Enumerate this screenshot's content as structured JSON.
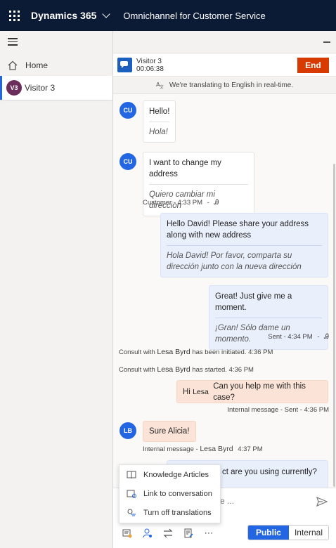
{
  "topbar": {
    "brand": "Dynamics 365",
    "app_name": "Omnichannel for Customer Service"
  },
  "nav": {
    "home_label": "Home",
    "visitor_initials": "V3",
    "visitor_label": "Visitor 3"
  },
  "session": {
    "name": "Visitor 3",
    "timer": "00:06:38",
    "end_label": "End"
  },
  "translate_banner": "We're translating to English in real-time.",
  "messages": [
    {
      "initials": "CU",
      "original": "Hello!",
      "translation": "Hola!"
    },
    {
      "initials": "CU",
      "original": "I want to change my address",
      "translation": "Quiero cambiar mi direccion",
      "meta": "Customer - 4:33 PM"
    },
    {
      "original": "Hello David! Please share your address along with new address",
      "translation": "Hola David! Por favor, comparta su dirección junto con la nueva dirección"
    },
    {
      "original": "Great! Just give me a moment.",
      "translation": "¡Gran! Sólo dame un momento.",
      "meta": "Sent - 4:34 PM"
    }
  ],
  "system": [
    {
      "prefix": "Consult with",
      "who": "Lesa Byrd",
      "suffix": "has been initiated. 4:36 PM"
    },
    {
      "prefix": "Consult with",
      "who": "Lesa Byrd",
      "suffix": "has started. 4:36 PM"
    }
  ],
  "internal_message": {
    "prefix": "Hi",
    "who": "Lesa",
    "text": "Can you help me with this case?",
    "meta": "Internal message - Sent - 4:36 PM"
  },
  "consultant_message": {
    "initials": "LB",
    "text": "Sure Alicia!",
    "meta_prefix": "Internal message -",
    "meta_who": "Lesa Byrd",
    "meta_time": "4:37 PM"
  },
  "partial_message": "ct are you using currently?",
  "compose": {
    "placeholder": "essage ..."
  },
  "popup_menu": [
    {
      "icon": "book-icon",
      "label": "Knowledge Articles"
    },
    {
      "icon": "link-icon",
      "label": "Link to conversation"
    },
    {
      "icon": "translate-icon",
      "label": "Turn off translations"
    }
  ],
  "toggle": {
    "public": "Public",
    "internal": "Internal"
  },
  "colors": {
    "topbar": "#0b1a35",
    "accent": "#2266e3",
    "end_button": "#d83b01",
    "agent_bubble": "#e9effb",
    "internal_bubble": "#fbe4d7"
  }
}
